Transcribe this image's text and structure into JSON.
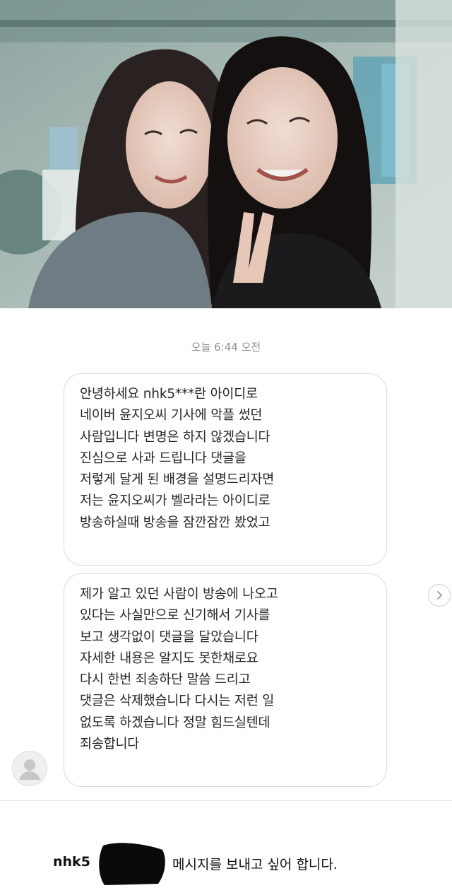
{
  "conversation": {
    "timestamp": "오늘 6:44 오전",
    "messages": [
      {
        "lines": [
          "안녕하세요 nhk5***란 아이디로",
          "네이버 윤지오씨 기사에 악플 썼던",
          "사람입니다 변명은 하지 않겠습니다",
          "진심으로 사과 드립니다 댓글을",
          "저렇게 달게 된 배경을 설명드리자면",
          "저는 윤지오씨가 벨라라는 아이디로",
          "방송하실때 방송을 잠깐잠깐 봤었고"
        ]
      },
      {
        "lines": [
          "제가 알고 있던 사람이 방송에 나오고",
          "있다는 사실만으로 신기해서 기사를",
          "보고 생각없이 댓글을 달았습니다",
          "자세한 내용은 알지도 못한채로요",
          "다시 한번 죄송하단 말씀 드리고",
          "댓글은 삭제했습니다 다시는 저런 일",
          "없도록 하겠습니다 정말 힘드실텐데",
          "죄송합니다"
        ]
      }
    ]
  },
  "request": {
    "username": "nhk5",
    "text": "메시지를 보내고 싶어 합니다."
  },
  "icons": {
    "avatar": "default-avatar-icon",
    "next": "chevron-right-icon"
  },
  "colors": {
    "bubble_border": "#dbdbdb",
    "timestamp": "#8e8e8e",
    "redaction": "#0a0a0a"
  }
}
